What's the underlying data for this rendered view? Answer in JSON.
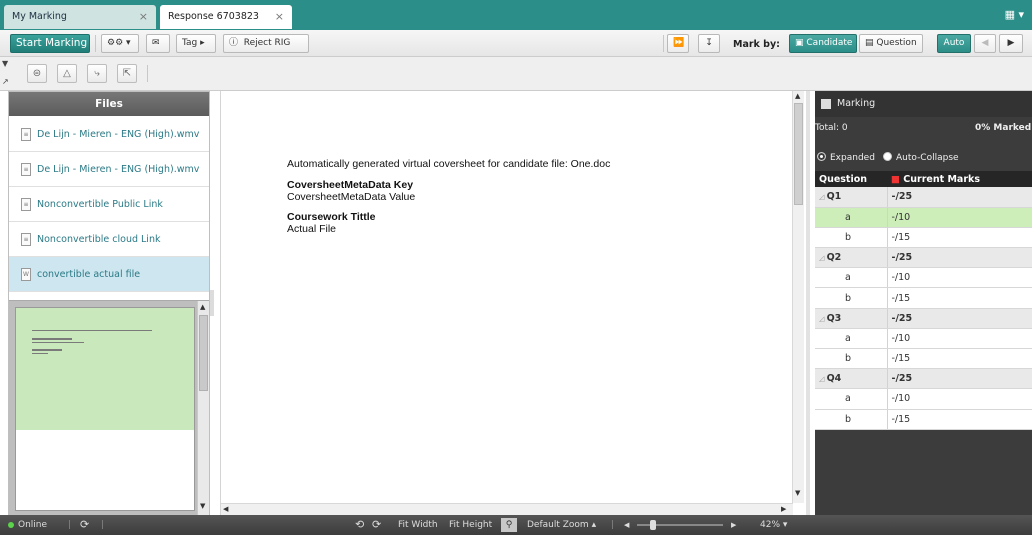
{
  "tabs": [
    {
      "label": "My Marking",
      "close": "×"
    },
    {
      "label": "Response 6703823",
      "close": "×"
    }
  ],
  "toolbar": {
    "start_marking": "Start Marking",
    "tag": "Tag",
    "reject_rig": "Reject RIG",
    "mark_by_label": "Mark by:",
    "candidate": "Candidate",
    "question": "Question",
    "auto": "Auto"
  },
  "files": {
    "header": "Files",
    "items": [
      {
        "label": "De Lijn - Mieren - ENG (High).wmv",
        "selected": false
      },
      {
        "label": "De Lijn - Mieren - ENG (High).wmv",
        "selected": false
      },
      {
        "label": "Nonconvertible Public Link",
        "selected": false
      },
      {
        "label": "Nonconvertible cloud Link",
        "selected": false
      },
      {
        "label": "convertible actual file",
        "selected": true
      }
    ]
  },
  "document": {
    "line1": "Automatically generated virtual coversheet for candidate file: One.doc",
    "meta_key": "CoversheetMetaData Key",
    "meta_value": "CoversheetMetaData Value",
    "coursework_title": "Coursework Tittle",
    "actual_file": "Actual File"
  },
  "marking": {
    "title": "Marking",
    "total_label": "Total: 0",
    "marked_label": "0% Marked",
    "expanded": "Expanded",
    "auto_collapse": "Auto-Collapse",
    "col_question": "Question",
    "col_marks": "Current Marks",
    "rows": [
      {
        "q": "Q1",
        "marks": "-/25",
        "type": "q"
      },
      {
        "q": "a",
        "marks": "-/10",
        "type": "sub",
        "highlight": true
      },
      {
        "q": "b",
        "marks": "-/15",
        "type": "sub"
      },
      {
        "q": "Q2",
        "marks": "-/25",
        "type": "q"
      },
      {
        "q": "a",
        "marks": "-/10",
        "type": "sub"
      },
      {
        "q": "b",
        "marks": "-/15",
        "type": "sub"
      },
      {
        "q": "Q3",
        "marks": "-/25",
        "type": "q"
      },
      {
        "q": "a",
        "marks": "-/10",
        "type": "sub"
      },
      {
        "q": "b",
        "marks": "-/15",
        "type": "sub"
      },
      {
        "q": "Q4",
        "marks": "-/25",
        "type": "q"
      },
      {
        "q": "a",
        "marks": "-/10",
        "type": "sub"
      },
      {
        "q": "b",
        "marks": "-/15",
        "type": "sub"
      }
    ]
  },
  "statusbar": {
    "online": "Online",
    "fit_width": "Fit Width",
    "fit_height": "Fit Height",
    "default_zoom": "Default Zoom",
    "zoom_percent": "42%",
    "zoom_level": 0.42
  },
  "colors": {
    "accent": "#2c8e88",
    "selection": "#cde6ef",
    "highlight": "#cdeeb9"
  }
}
